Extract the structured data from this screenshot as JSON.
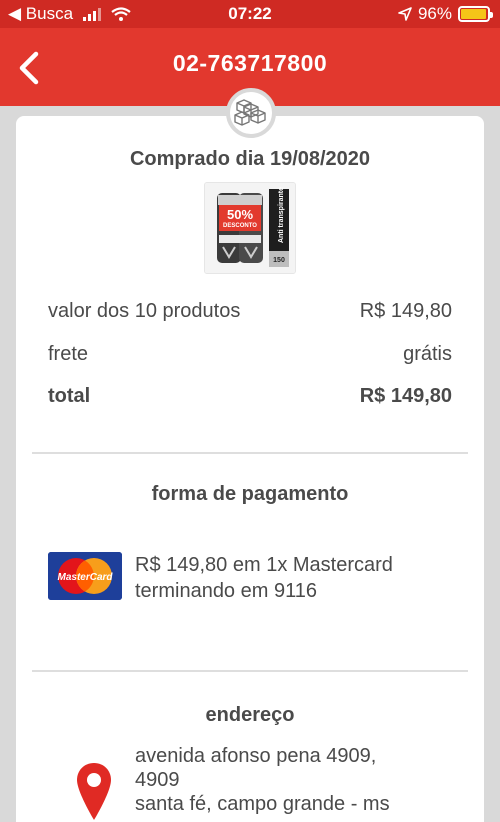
{
  "status_bar": {
    "back_label": "◀ Busca",
    "time": "07:22",
    "battery_text": "96%",
    "battery_level": 0.96
  },
  "header": {
    "title": "02-763717800",
    "back_icon": "chevron-left-icon"
  },
  "order": {
    "purchase_date": "Comprado dia 19/08/2020",
    "product_image_alt": "anti-transpirante 50% desconto",
    "product_image_text": {
      "badge_percent": "50%",
      "badge_label": "DESCONTO",
      "side_label": "Anti transpirante",
      "size": "150"
    },
    "summary": [
      {
        "label": "valor dos 10 produtos",
        "value": "R$ 149,80"
      },
      {
        "label": "frete",
        "value": "grátis"
      },
      {
        "label": "total",
        "value": "R$ 149,80"
      }
    ]
  },
  "payment": {
    "title": "forma de pagamento",
    "card_brand": "MasterCard",
    "description": "R$ 149,80 em 1x Mastercard terminando em 9116"
  },
  "address": {
    "title": "endereço",
    "line1": "avenida afonso pena 4909,",
    "line2": "4909",
    "line3": "santa fé, campo grande - ms"
  },
  "colors": {
    "header_red": "#e2382e",
    "status_red": "#cf2a23",
    "text_gray": "#4a4a4a",
    "pin_red": "#e02a24",
    "mastercard_blue": "#1e3f9a"
  }
}
